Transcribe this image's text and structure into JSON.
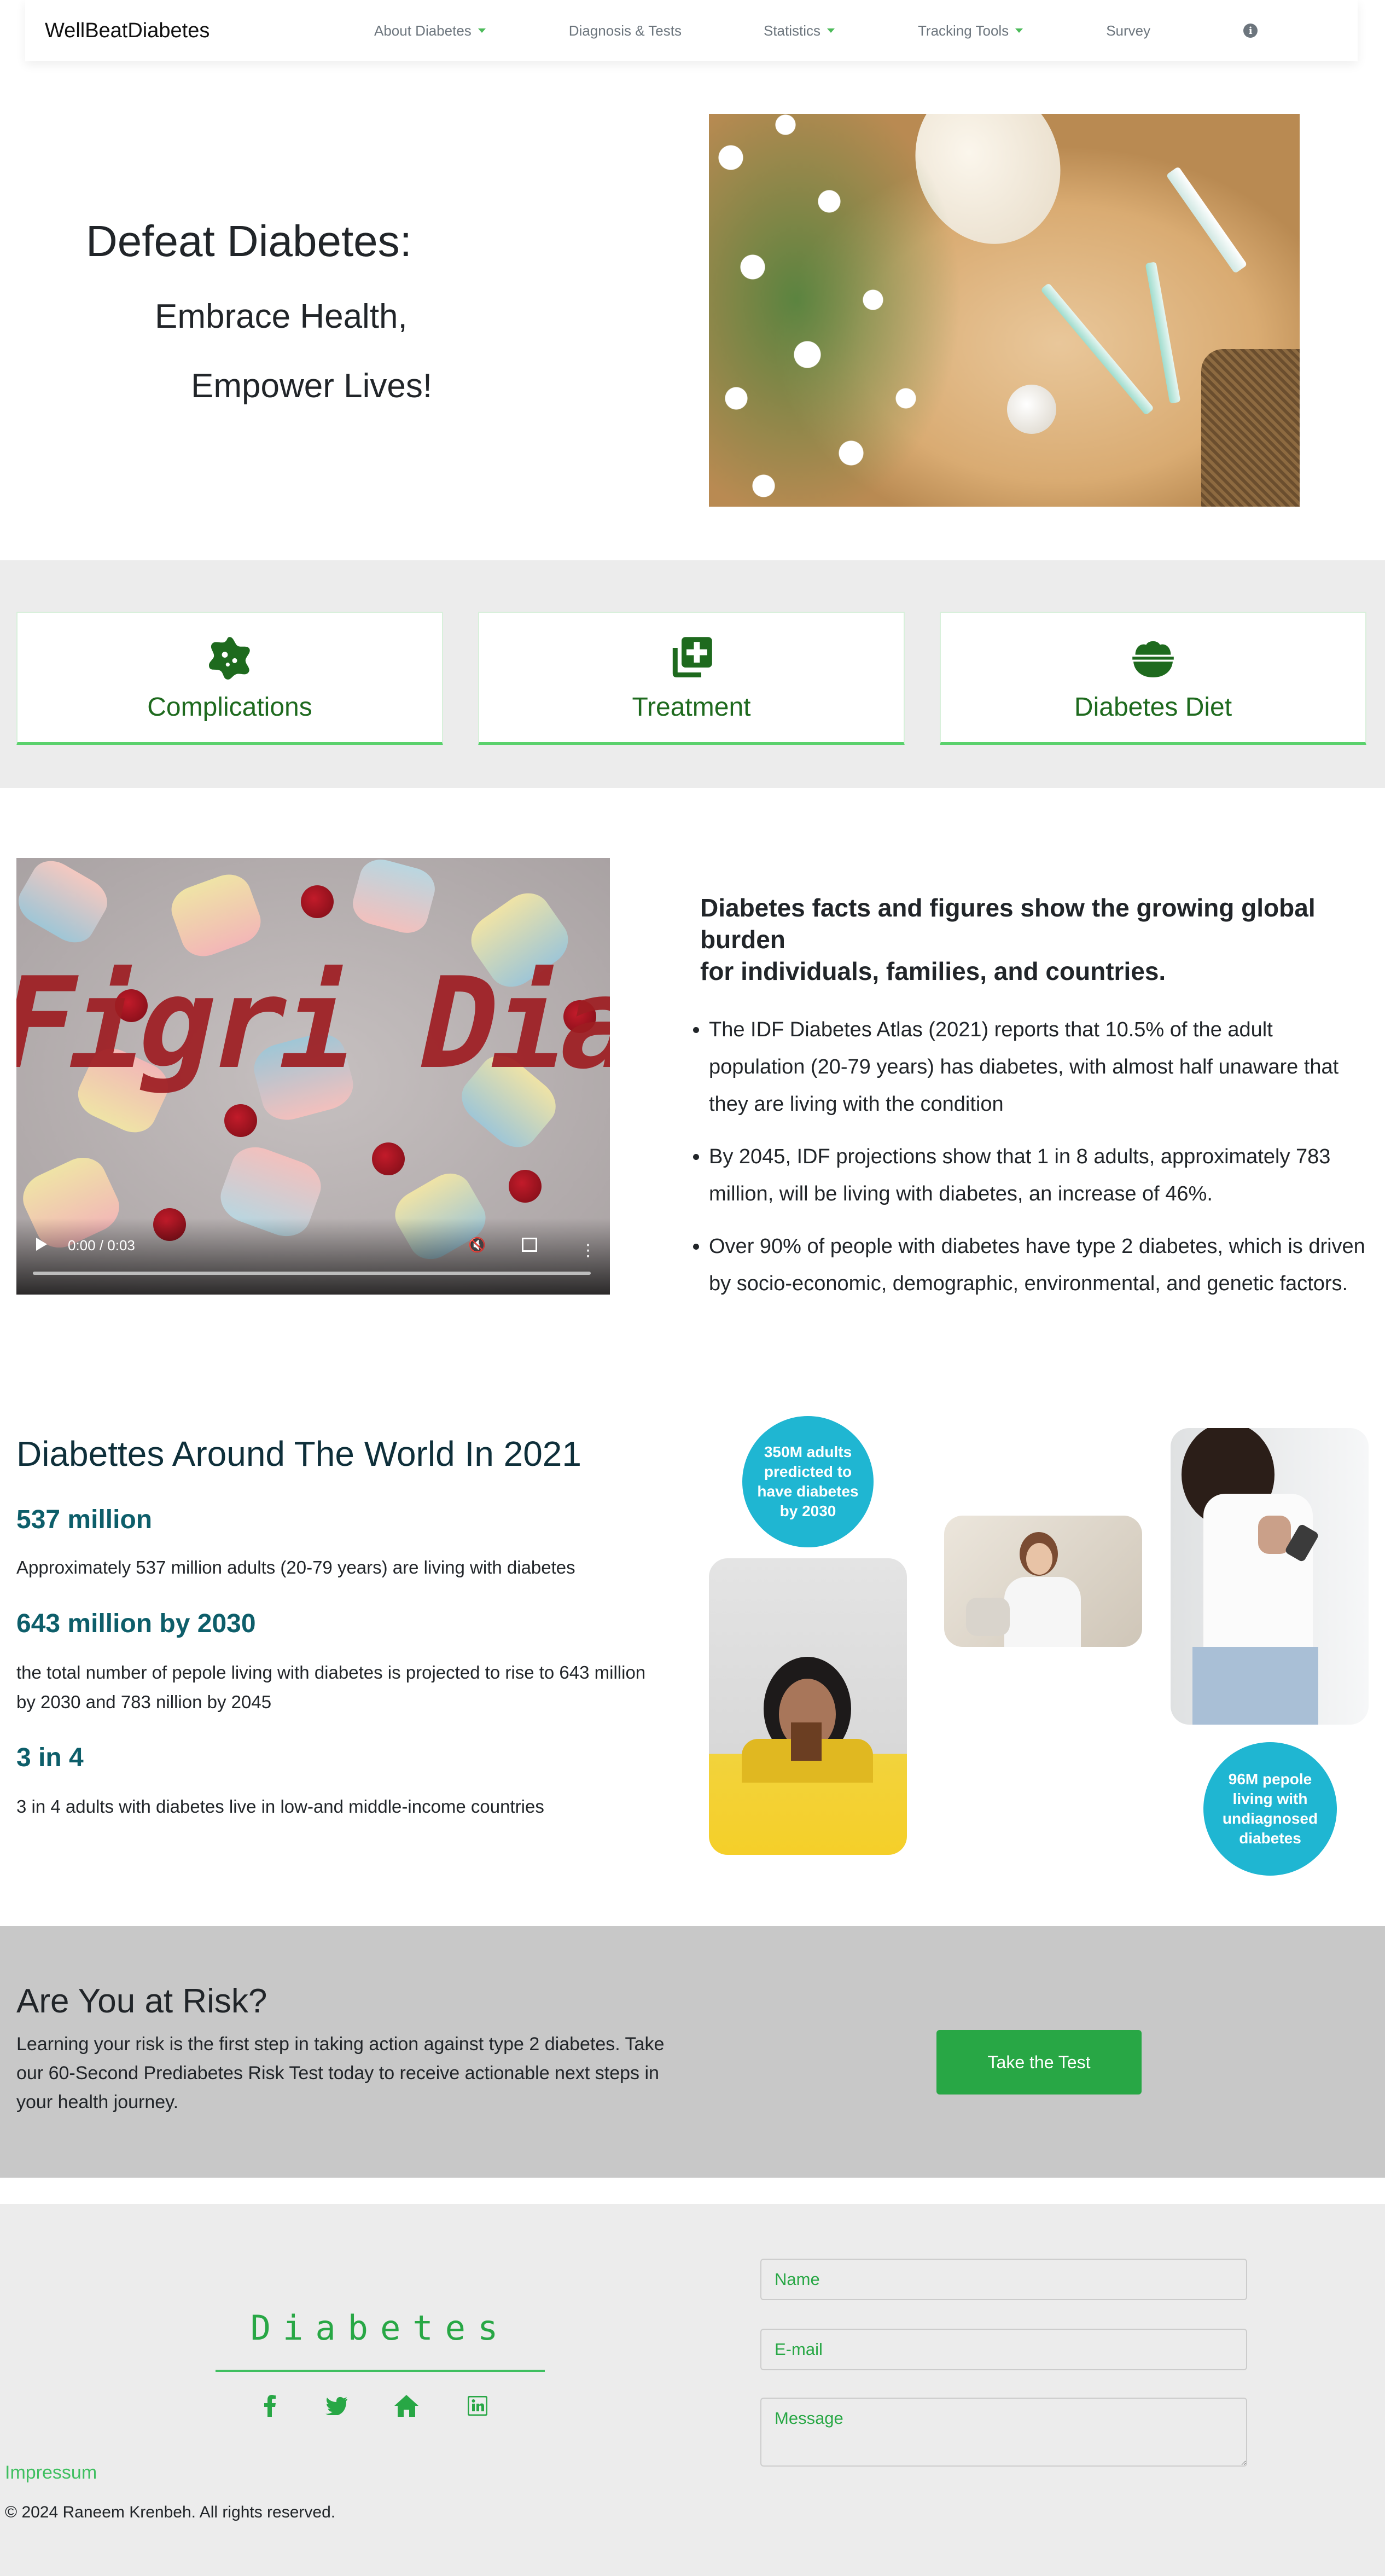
{
  "navbar": {
    "brand": "WellBeatDiabetes",
    "items": [
      {
        "label": "About Diabetes",
        "dropdown": true
      },
      {
        "label": "Diagnosis & Tests",
        "dropdown": false
      },
      {
        "label": "Statistics",
        "dropdown": true
      },
      {
        "label": "Tracking Tools",
        "dropdown": true
      },
      {
        "label": "Survey",
        "dropdown": false
      }
    ],
    "info_icon": "info-icon",
    "info_glyph": "i"
  },
  "hero": {
    "title": "Defeat Diabetes:",
    "line2": "Embrace Health,",
    "line3": "Empower Lives!"
  },
  "features": [
    {
      "label": "Complications",
      "icon": "virus-icon"
    },
    {
      "label": "Treatment",
      "icon": "medical-copy-icon"
    },
    {
      "label": "Diabetes Diet",
      "icon": "bowl-icon"
    }
  ],
  "video": {
    "title_text": "Figri Diabetes",
    "time": "0:00 / 0:03"
  },
  "facts": {
    "heading_line1": "Diabetes facts and figures show the growing global burden",
    "heading_line2": "for individuals, families, and countries.",
    "items": [
      "The IDF Diabetes Atlas (2021) reports that 10.5% of the adult population (20-79 years) has diabetes, with almost half unaware that they are living with the condition",
      "By 2045, IDF projections show that 1 in 8 adults, approximately 783 million, will be living with diabetes, an increase of 46%.",
      "Over 90% of people with diabetes have type 2 diabetes, which is driven by socio-economic, demographic, environmental, and genetic factors."
    ]
  },
  "stats": {
    "heading": "Diabettes Around The World In 2021",
    "items": [
      {
        "number": "537 million",
        "desc": "Approximately 537 million adults (20-79 years) are living with diabetes"
      },
      {
        "number": "643 million by 2030",
        "desc": "the total number of pepole living with diabetes is projected to rise to 643 million by 2030 and 783 nillion by 2045"
      },
      {
        "number": "3 in 4",
        "desc": "3 in 4 adults with diabetes live in low-and middle-income countries"
      }
    ],
    "bubble1": "350M adults predicted to have diabetes by 2030",
    "bubble2": "96M pepole living with undiagnosed diabetes"
  },
  "risk": {
    "heading": "Are You at Risk?",
    "text": "Learning your risk is the first step in taking action against type 2 diabetes. Take our 60-Second Prediabetes Risk Test today to receive actionable next steps in your health journey.",
    "button": "Take the Test"
  },
  "footer": {
    "brand": "Diabetes",
    "social_icons": [
      "facebook-icon",
      "twitter-icon",
      "home-icon",
      "linkedin-icon"
    ],
    "form": {
      "name_placeholder": "Name",
      "email_placeholder": "E-mail",
      "message_placeholder": "Message"
    },
    "impressum": "Impressum",
    "copyright": "© 2024 Raneem Krenbeh. All rights reserved."
  },
  "colors": {
    "accent_green": "#28a745",
    "card_title_green": "#1e6a1e",
    "bubble_blue": "#1fb6d2",
    "stat_teal": "#0d5e6a"
  }
}
